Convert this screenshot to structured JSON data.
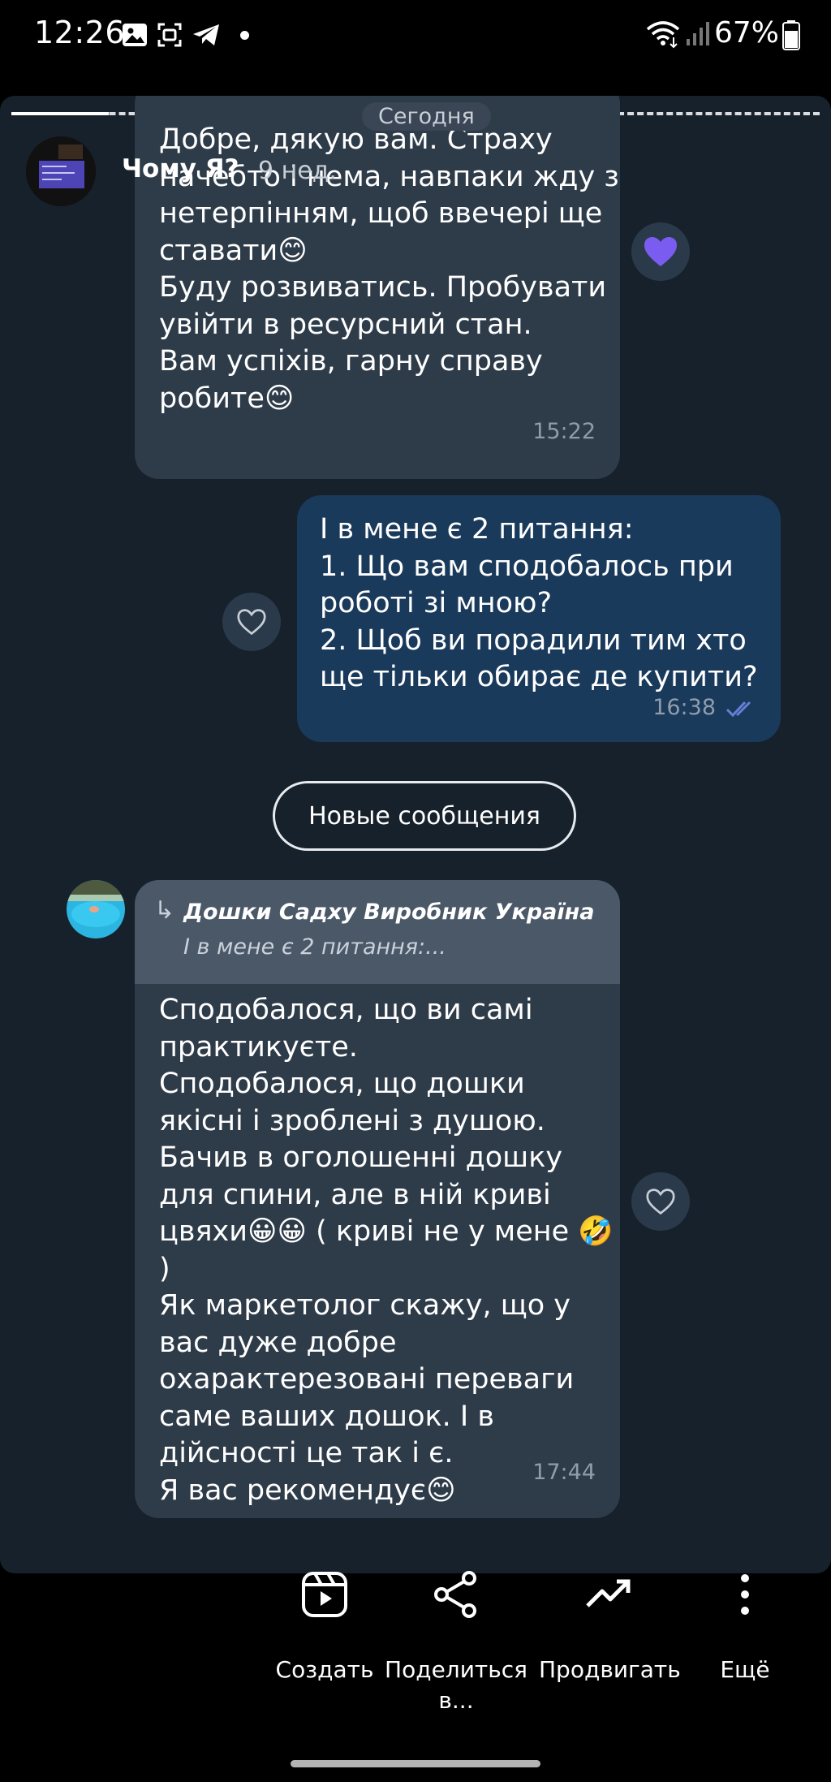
{
  "status_bar": {
    "time": "12:26",
    "battery": "67%",
    "icons": [
      "gallery-icon",
      "screenshot-icon",
      "telegram-icon",
      "notification-dot",
      "wifi-icon",
      "signal-icon",
      "battery-icon"
    ]
  },
  "story": {
    "user_name": "Чому Я?",
    "posted_ago": "9 нед.",
    "date_chip": "Сегодня",
    "new_messages_label": "Новые сообщения",
    "messages": [
      {
        "direction": "in",
        "lines": [
          "Добре, дякую вам. Страху",
          "начебто і нема, навпаки жду з",
          "нетерпінням, щоб ввечері ще",
          "ставати😊",
          "Буду розвиватись. Пробувати",
          "увійти в ресурсний стан.",
          "Вам успіхів, гарну справу",
          "робите😊"
        ],
        "time": "15:22",
        "reaction": "filled-heart"
      },
      {
        "direction": "out",
        "lines": [
          "І в мене є 2 питання:",
          "1. Що вам сподобалось при",
          "роботі зі мною?",
          "2. Щоб ви порадили тим хто",
          "ще тільки обирає де купити?"
        ],
        "time": "16:38",
        "status": "read"
      },
      {
        "direction": "in",
        "reply_to_name": "Дошки Садху Виробник Україна",
        "reply_to_text": "І в мене є 2 питання:...",
        "lines": [
          "Сподобалося, що ви самі",
          "практикуєте.",
          "Сподобалося, що дошки",
          "якісні і зроблені з душою.",
          "Бачив в оголошенні дошку",
          "для спини, але в ній криві",
          "цвяхи😀😀 ( криві не у мене 🤣 )",
          "Як маркетолог скажу, що у",
          "вас дуже добре",
          "охарактерезовані переваги",
          "саме ваших дошок. І в",
          "дійсності це так і є.",
          "Я вас рекомендує😊"
        ],
        "time": "17:44"
      }
    ]
  },
  "actions": [
    {
      "label": "Создать",
      "icon": "create-reel-icon"
    },
    {
      "label": "Поделиться в...",
      "icon": "share-icon"
    },
    {
      "label": "Продвигать",
      "icon": "trend-up-icon"
    },
    {
      "label": "Ещё",
      "icon": "more-vertical-icon"
    }
  ],
  "colors": {
    "story_bg": "#17212b",
    "incoming_bubble": "#2e3b49",
    "outgoing_bubble": "#1a3a5b",
    "reaction_heart": "#7b5cf0",
    "read_check": "#6a7dd8"
  }
}
